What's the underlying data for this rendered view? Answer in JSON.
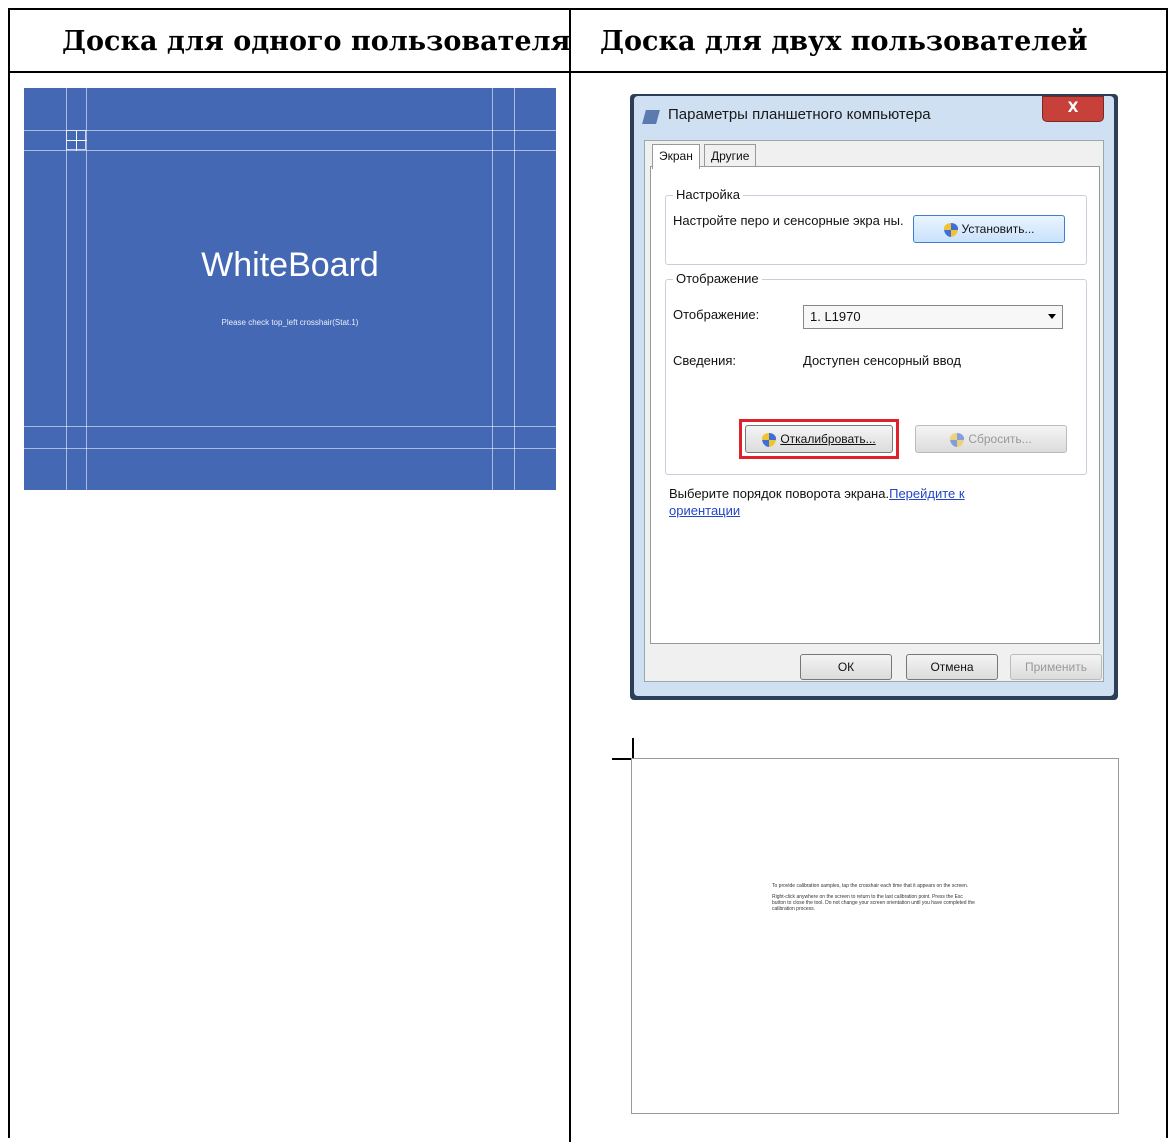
{
  "headers": {
    "left": "Доска для одного пользователя",
    "right": "Доска для двух пользователей"
  },
  "whiteboard": {
    "title": "WhiteBoard",
    "subtitle": "Please check top_left crosshair(Stat.1)"
  },
  "dialog": {
    "title": "Параметры планшетного компьютера",
    "close_label": "X",
    "tabs": [
      "Экран",
      "Другие"
    ],
    "setup_group_title": "Настройка",
    "setup_text": "Настройте перо и сенсорные экра ны.",
    "setup_button": "Установить...",
    "display_group_title": "Отображение",
    "display_label": "Отображение:",
    "display_value": "1. L1970",
    "info_label": "Сведения:",
    "info_value": "Доступен сенсорный ввод",
    "calibrate_button": "Откалибровать...",
    "reset_button": "Сбросить...",
    "rotation_text": "Выберите порядок поворота экрана.",
    "rotation_link": "Перейдите к ориентации",
    "ok_button": "ОК",
    "cancel_button": "Отмена",
    "apply_button": "Применить",
    "highlight_color": "#e0202a"
  },
  "calibration": {
    "paragraph1": "To provide calibration samples, tap the crosshair each time that it appears on the screen.",
    "paragraph2": "Right-click anywhere on the screen to return to the last calibration point. Press the Esc button to close the tool. Do not change your screen orientation until you have completed the calibration process."
  }
}
